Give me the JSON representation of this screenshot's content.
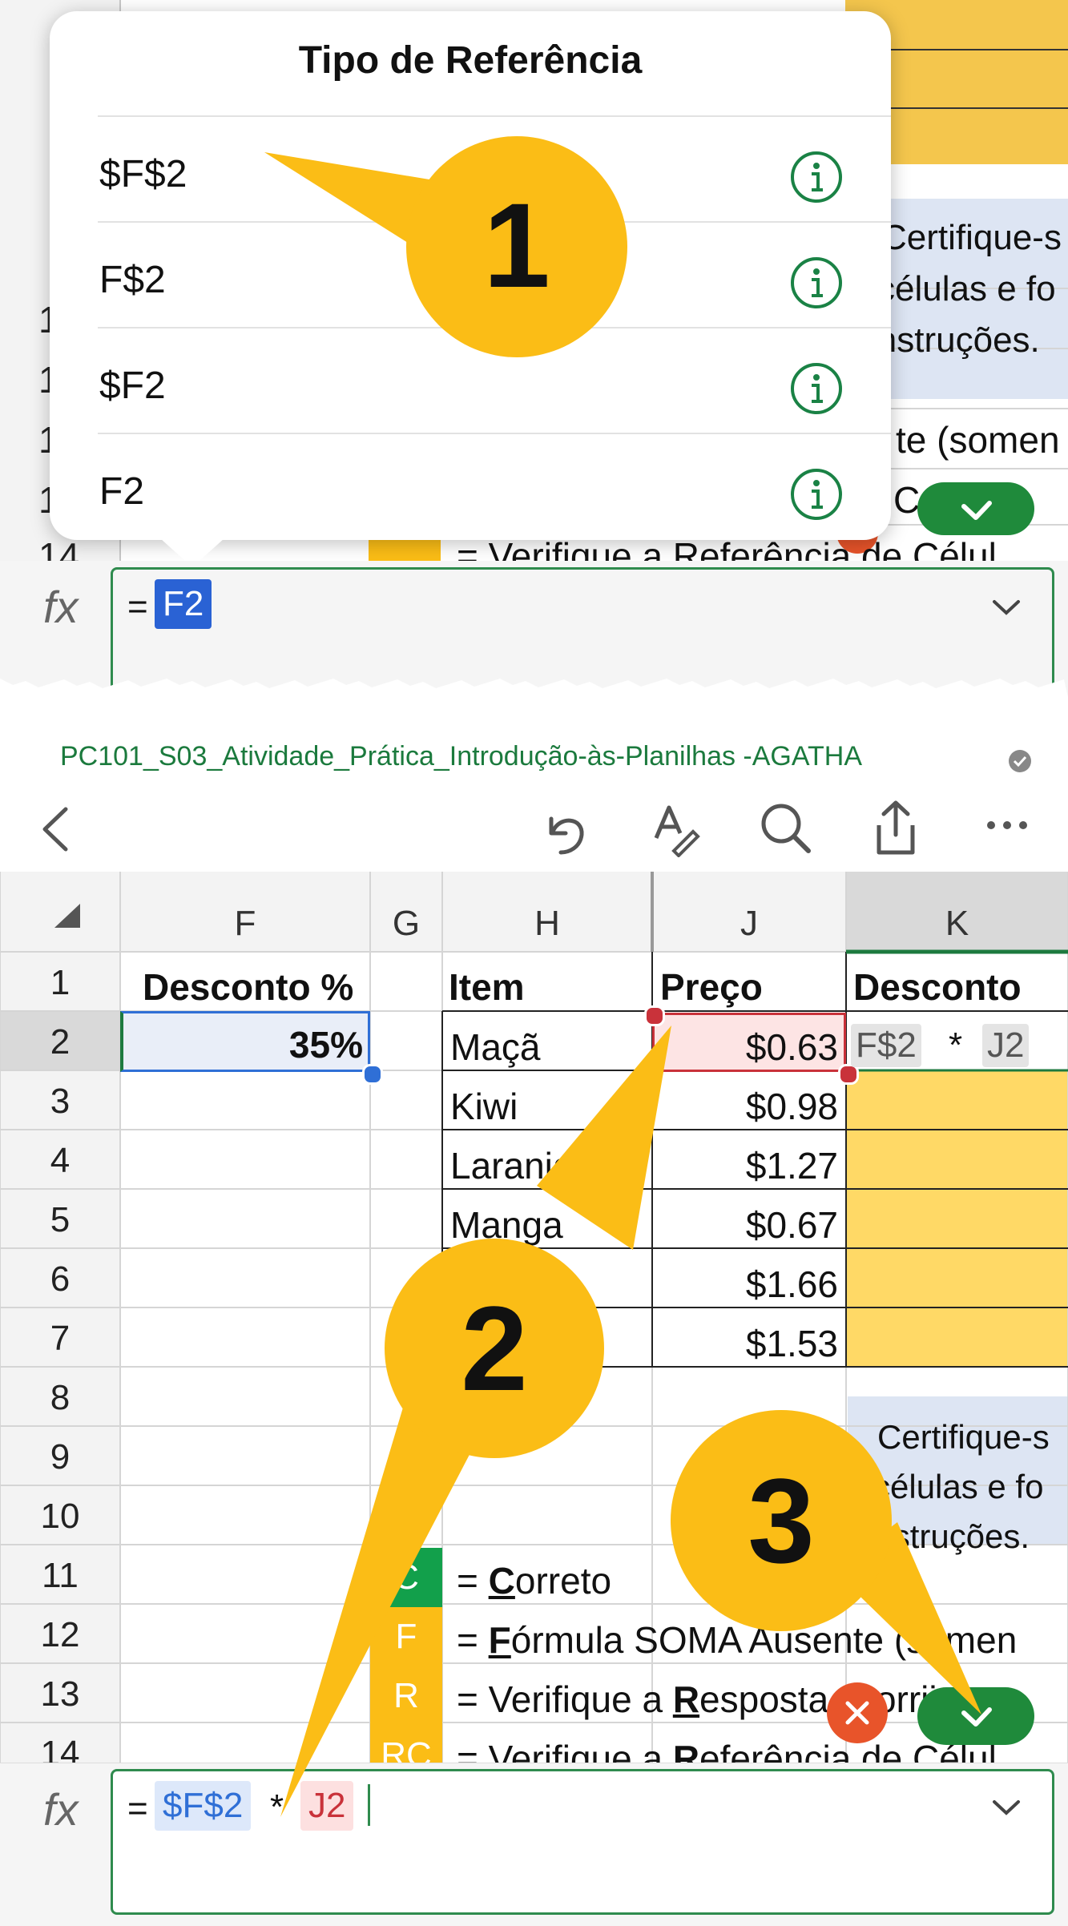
{
  "popup": {
    "title": "Tipo de Referência",
    "options": [
      "$F$2",
      "F$2",
      "$F2",
      "F2"
    ]
  },
  "top_formula": {
    "eq": "=",
    "token": "F2"
  },
  "file_title": "PC101_S03_Atividade_Prática_Introdução-às-Planilhas -AGATHA",
  "columns": [
    "F",
    "G",
    "H",
    "J",
    "K"
  ],
  "rows": [
    "1",
    "2",
    "3",
    "4",
    "5",
    "6",
    "7",
    "8",
    "9",
    "10",
    "11",
    "12",
    "13",
    "14"
  ],
  "top_rows": [
    "1",
    "1",
    "1",
    "1",
    "14"
  ],
  "sheet": {
    "F1": "Desconto %",
    "F2": "35%",
    "H1": "Item",
    "J1": "Preço",
    "K1": "Desconto",
    "items": [
      "Maçã",
      "Kiwi",
      "Laranja",
      "Manga"
    ],
    "prices": [
      "$0.63",
      "$0.98",
      "$1.27",
      "$0.67",
      "$1.66",
      "$1.53"
    ],
    "k2_ref1": "F$2",
    "k2_op": "*",
    "k2_ref2": "J2",
    "note_lines": [
      "Certifique-s",
      "células e fo",
      "instruções."
    ],
    "legend": [
      {
        "code": "C",
        "color": "#12a04b",
        "pre": "= ",
        "u": "C",
        "rest": "orreto"
      },
      {
        "code": "F",
        "color": "#fbbd16",
        "pre": "= ",
        "u": "F",
        "rest": "órmula SOMA Ausente (somen"
      },
      {
        "code": "R",
        "color": "#fbbd16",
        "pre": "= Verifique a ",
        "u": "R",
        "rest": "esposta, Corrija a"
      },
      {
        "code": "RC",
        "color": "#fbbd16",
        "pre": "= Verifique a ",
        "u": "R",
        "rest": "eferência de Célul"
      }
    ],
    "top_partial": {
      "note_lines": [
        "Certifique-s",
        "células e fo",
        "instruções."
      ],
      "row12": "te (somen",
      "row13": "Corrija a",
      "row14": "= Verifique a Referência de Célul"
    }
  },
  "bottom_formula": {
    "eq": "=",
    "ref1": "$F$2",
    "op": "*",
    "ref2": "J2"
  },
  "callouts": [
    "1",
    "2",
    "3"
  ],
  "icons": [
    "info-icon",
    "back-icon",
    "undo-icon",
    "pen-icon",
    "search-icon",
    "share-icon",
    "more-icon",
    "fx-icon",
    "chevron-down-icon",
    "check-icon",
    "close-icon"
  ],
  "colors": {
    "callout": "#fbbd16",
    "excel_green": "#1d7a3f",
    "selection_blue": "#2f6fd6",
    "ref_red": "#c9323a",
    "highlight_yellow": "#ffd966",
    "note_blue": "#dde5f3"
  }
}
